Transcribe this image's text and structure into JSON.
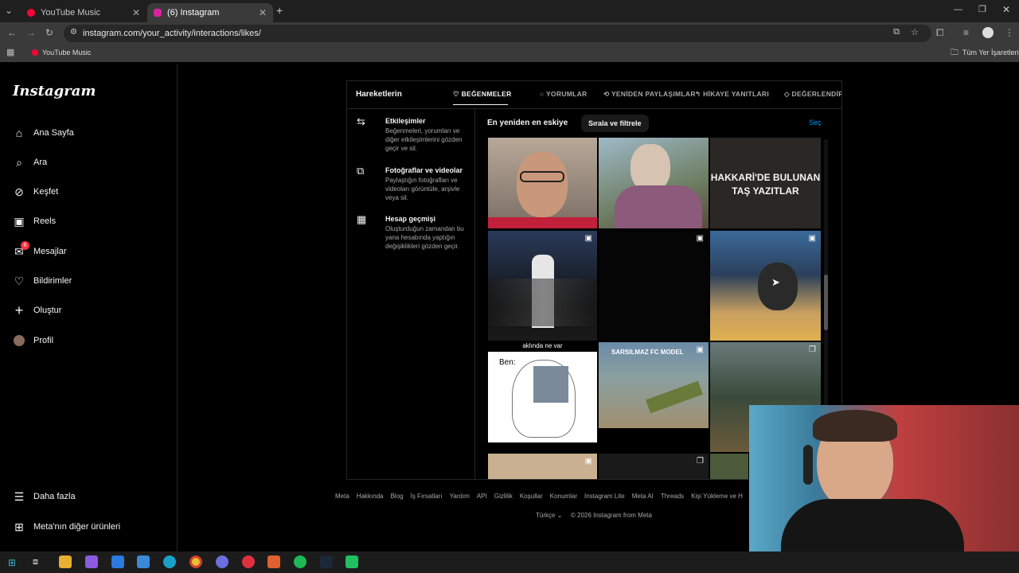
{
  "browser": {
    "tabs": [
      {
        "title": "YouTube Music",
        "color": "#ff0033"
      },
      {
        "title": "(6) Instagram",
        "color": "#d6249f"
      }
    ],
    "url": "instagram.com/your_activity/interactions/likes/",
    "bookmark": "YouTube Music",
    "all_bookmarks": "Tüm Yer İşaretleri"
  },
  "instagram": {
    "logo": "Instagram",
    "nav": [
      {
        "label": "Ana Sayfa",
        "icon": "home-icon"
      },
      {
        "label": "Ara",
        "icon": "search-icon"
      },
      {
        "label": "Keşfet",
        "icon": "compass-icon"
      },
      {
        "label": "Reels",
        "icon": "reels-icon"
      },
      {
        "label": "Mesajlar",
        "icon": "messenger-icon",
        "badge": "6"
      },
      {
        "label": "Bildirimler",
        "icon": "heart-icon"
      },
      {
        "label": "Oluştur",
        "icon": "plus-icon"
      },
      {
        "label": "Profil",
        "icon": "avatar-icon"
      }
    ],
    "more": "Daha fazla",
    "meta_products": "Meta'nın diğer ürünleri",
    "activity": {
      "heading": "Hareketlerin",
      "tabs": [
        "BEĞENMELER",
        "YORUMLAR",
        "YENİDEN PAYLAŞIMLAR",
        "HİKAYE YANITLARI",
        "DEĞERLENDİR"
      ],
      "categories": [
        {
          "title": "Etkileşimler",
          "desc": "Beğenmeleri, yorumları ve diğer etkileşimlerini gözden geçir ve sil.",
          "icon": "arrows-icon"
        },
        {
          "title": "Fotoğraflar ve videolar",
          "desc": "Paylaştığın fotoğrafları ve videoları görüntüle, arşivle veya sil.",
          "icon": "media-icon"
        },
        {
          "title": "Hesap geçmişi",
          "desc": "Oluşturduğun zamandan bu yana hesabında yaptığın değişiklikleri gözden geçir.",
          "icon": "calendar-icon"
        }
      ],
      "sort_label": "En yeniden en eskiye",
      "filter_button": "Sırala ve filtrele",
      "select": "Seç",
      "grid_texts": {
        "hakkari": "HAKKARİ'DE BULUNAN TAŞ YAZITLAR",
        "aklinda": "aklında ne var",
        "ben": "Ben:",
        "sarsilmaz": "SARSILMAZ FC MODEL"
      }
    },
    "footer_links": [
      "Meta",
      "Hakkında",
      "Blog",
      "İş Fırsatları",
      "Yardım",
      "API",
      "Gizlilik",
      "Koşullar",
      "Konumlar",
      "Instagram Lite",
      "Meta AI",
      "Threads",
      "Kişi Yükleme ve H"
    ],
    "language": "Türkçe",
    "copyright": "© 2026 Instagram from Meta"
  },
  "colors": {
    "accent": "#0095f6",
    "bg": "#000000",
    "badge": "#ff3040"
  }
}
